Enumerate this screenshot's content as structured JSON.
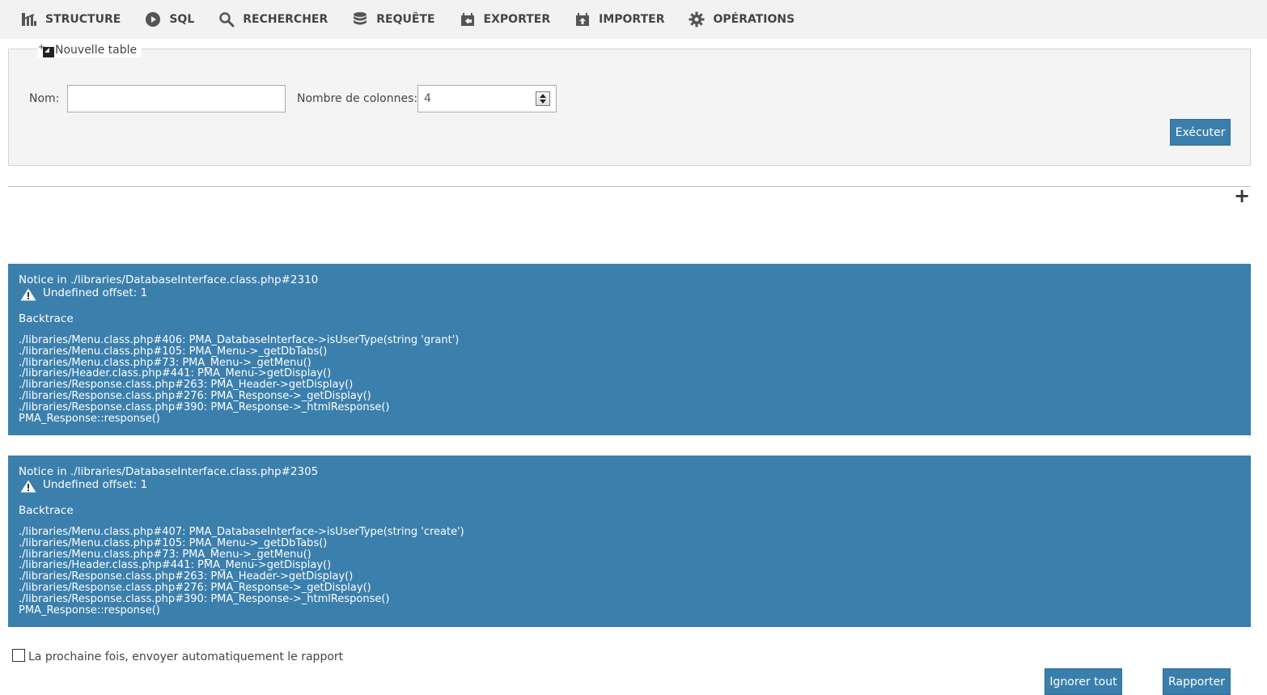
{
  "tabs": [
    {
      "label": "STRUCTURE",
      "icon": "structure-icon"
    },
    {
      "label": "SQL",
      "icon": "sql-icon"
    },
    {
      "label": "RECHERCHER",
      "icon": "search-icon"
    },
    {
      "label": "REQUÊTE",
      "icon": "database-icon"
    },
    {
      "label": "EXPORTER",
      "icon": "export-icon"
    },
    {
      "label": "IMPORTER",
      "icon": "import-icon"
    },
    {
      "label": "OPÉRATIONS",
      "icon": "gear-icon"
    }
  ],
  "new_table": {
    "legend": "Nouvelle table",
    "name_label": "Nom:",
    "name_value": "",
    "columns_label": "Nombre de colonnes:",
    "columns_value": "4",
    "submit_label": "Exécuter"
  },
  "notices": [
    {
      "title": "Notice in ./libraries/DatabaseInterface.class.php#2310",
      "message": "Undefined offset: 1",
      "backtrace_label": "Backtrace",
      "lines": [
        "./libraries/Menu.class.php#406: PMA_DatabaseInterface->isUserType(string 'grant')",
        "./libraries/Menu.class.php#105: PMA_Menu->_getDbTabs()",
        "./libraries/Menu.class.php#73: PMA_Menu->_getMenu()",
        "./libraries/Header.class.php#441: PMA_Menu->getDisplay()",
        "./libraries/Response.class.php#263: PMA_Header->getDisplay()",
        "./libraries/Response.class.php#276: PMA_Response->_getDisplay()",
        "./libraries/Response.class.php#390: PMA_Response->_htmlResponse()",
        "PMA_Response::response()"
      ]
    },
    {
      "title": "Notice in ./libraries/DatabaseInterface.class.php#2305",
      "message": "Undefined offset: 1",
      "backtrace_label": "Backtrace",
      "lines": [
        "./libraries/Menu.class.php#407: PMA_DatabaseInterface->isUserType(string 'create')",
        "./libraries/Menu.class.php#105: PMA_Menu->_getDbTabs()",
        "./libraries/Menu.class.php#73: PMA_Menu->_getMenu()",
        "./libraries/Header.class.php#441: PMA_Menu->getDisplay()",
        "./libraries/Response.class.php#263: PMA_Header->getDisplay()",
        "./libraries/Response.class.php#276: PMA_Response->_getDisplay()",
        "./libraries/Response.class.php#390: PMA_Response->_htmlResponse()",
        "PMA_Response::response()"
      ]
    }
  ],
  "auto_report": {
    "label": "La prochaine fois, envoyer automatiquement le rapport",
    "checked": false
  },
  "buttons": {
    "ignore_all": "Ignorer tout",
    "report": "Rapporter"
  },
  "colors": {
    "accent": "#3b7fad",
    "menu_bg": "#f2f2f2",
    "panel_bg": "#f4f4f4"
  }
}
